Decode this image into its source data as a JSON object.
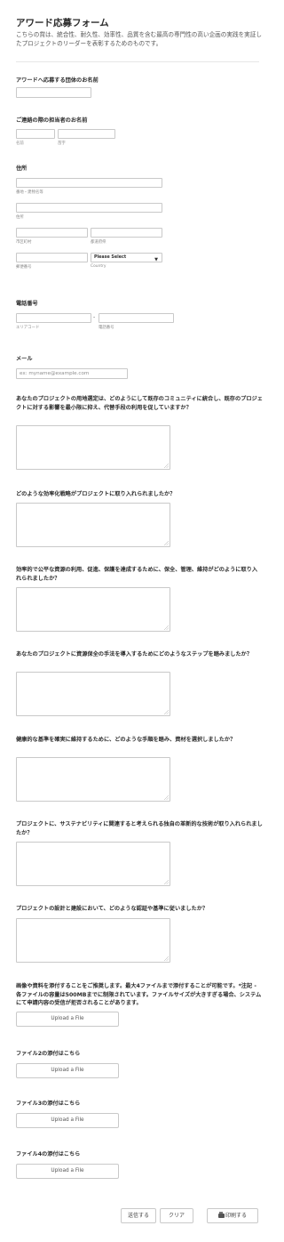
{
  "header": {
    "title": "アワード応募フォーム",
    "subtitle": "こちらの賞は、統合性、耐久性、効率性、品質を含む最高の専門性の高い企画の実践を実証したプロジェクトのリーダーを表彰するためのものです。"
  },
  "org_name": {
    "label": "アワードへ応募する団体のお名前",
    "value": ""
  },
  "contact": {
    "label": "ご連絡の際の担当者のお名前",
    "first_sub": "名前",
    "last_sub": "苗字"
  },
  "address": {
    "label": "住所",
    "line1_sub": "番地・建物名等",
    "line2_sub": "住所",
    "city_sub": "市区町村",
    "state_sub": "都道府県",
    "zip_sub": "郵便番号",
    "country_value": "Please Select",
    "country_sub": "Country"
  },
  "phone": {
    "label": "電話番号",
    "area_sub": "エリアコード",
    "number_sub": "電話番号",
    "separator": "-"
  },
  "email": {
    "label": "メール",
    "placeholder": "ex: myname@example.com"
  },
  "questions": [
    {
      "label": "あなたのプロジェクトの用地選定は、どのようにして既存のコミュニティに統合し、既存のプロジェクトに対する影響を最小限に抑え、代替手段の利用を促していますか？"
    },
    {
      "label": "どのような効率化戦略がプロジェクトに取り入れられましたか？"
    },
    {
      "label": "効率的で公平な資源の利用、促進、保護を達成するために、保全、管理、維持がどのように取り入れられましたか？"
    },
    {
      "label": "あなたのプロジェクトに資源保全の手法を導入するためにどのようなステップを踏みましたか？"
    },
    {
      "label": "健康的な基準を確実に維持するために、どのような手順を踏み、資材を選択しましたか？"
    },
    {
      "label": "プロジェクトに、サステナビリティに関連すると考えられる独自の革新的な技術が取り入れられましたか？"
    },
    {
      "label": "プロジェクトの設計と建設において、どのような認証や基準に従いましたか？"
    }
  ],
  "uploads": [
    {
      "label": "画像や資料を添付することをご推奨します。最大4ファイルまで添付することが可能です。*注記 - 各ファイルの容量は500MBまでに制限されています。ファイルサイズが大きすぎる場合、システムにて申請内容の受信が拒否されることがあります。",
      "button": "Upload a File"
    },
    {
      "label": "ファイル2の添付はこちら",
      "button": "Upload a File"
    },
    {
      "label": "ファイル3の添付はこちら",
      "button": "Upload a File"
    },
    {
      "label": "ファイル4の添付はこちら",
      "button": "Upload a File"
    }
  ],
  "actions": {
    "submit": "送信する",
    "clear": "クリア",
    "print": "印刷する"
  }
}
